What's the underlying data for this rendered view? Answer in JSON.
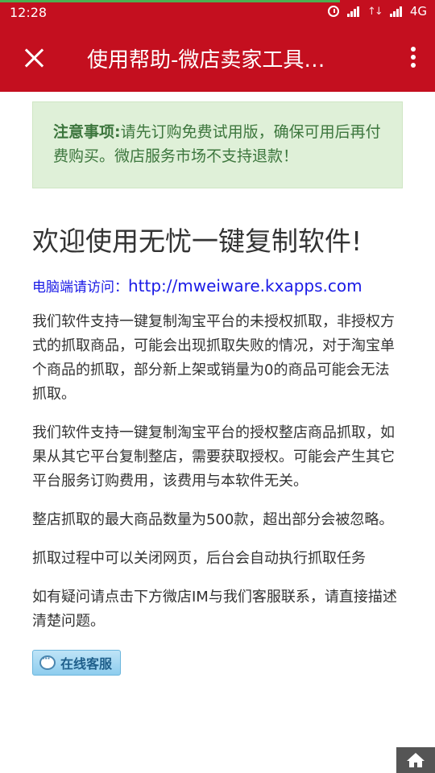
{
  "status_bar": {
    "time": "12:28",
    "network": "4G",
    "signal_icon": "signal-icon",
    "alarm_icon": "alarm-icon"
  },
  "app_bar": {
    "title": "使用帮助-微店卖家工具…",
    "close_icon": "close-icon",
    "more_icon": "more-vertical-icon"
  },
  "notice": {
    "label": "注意事项:",
    "text": "请先订购免费试用版，确保可用后再付费购买。微店服务市场不支持退款！"
  },
  "heading": "欢迎使用无忧一键复制软件!",
  "visit": {
    "label": "电脑端请访问：",
    "url": "http://mweiware.kxapps.com"
  },
  "paragraphs": [
    "我们软件支持一键复制淘宝平台的未授权抓取，非授权方式的抓取商品，可能会出现抓取失败的情况，对于淘宝单个商品的抓取，部分新上架或销量为0的商品可能会无法抓取。",
    "我们软件支持一键复制淘宝平台的授权整店商品抓取，如果从其它平台复制整店，需要获取授权。可能会产生其它平台服务订购费用，该费用与本软件无关。",
    "整店抓取的最大商品数量为500款，超出部分会被忽略。",
    "抓取过程中可以关闭网页，后台会自动执行抓取任务",
    "如有疑问请点击下方微店IM与我们客服联系，请直接描述清楚问题。"
  ],
  "online_service": {
    "label": "在线客服",
    "icon": "chat-bubble-icon"
  },
  "home_button": {
    "icon": "home-icon"
  },
  "colors": {
    "header": "#c40f1f",
    "notice_bg": "#dff0d8",
    "notice_text": "#3c763d",
    "link": "#1a1ae6"
  }
}
